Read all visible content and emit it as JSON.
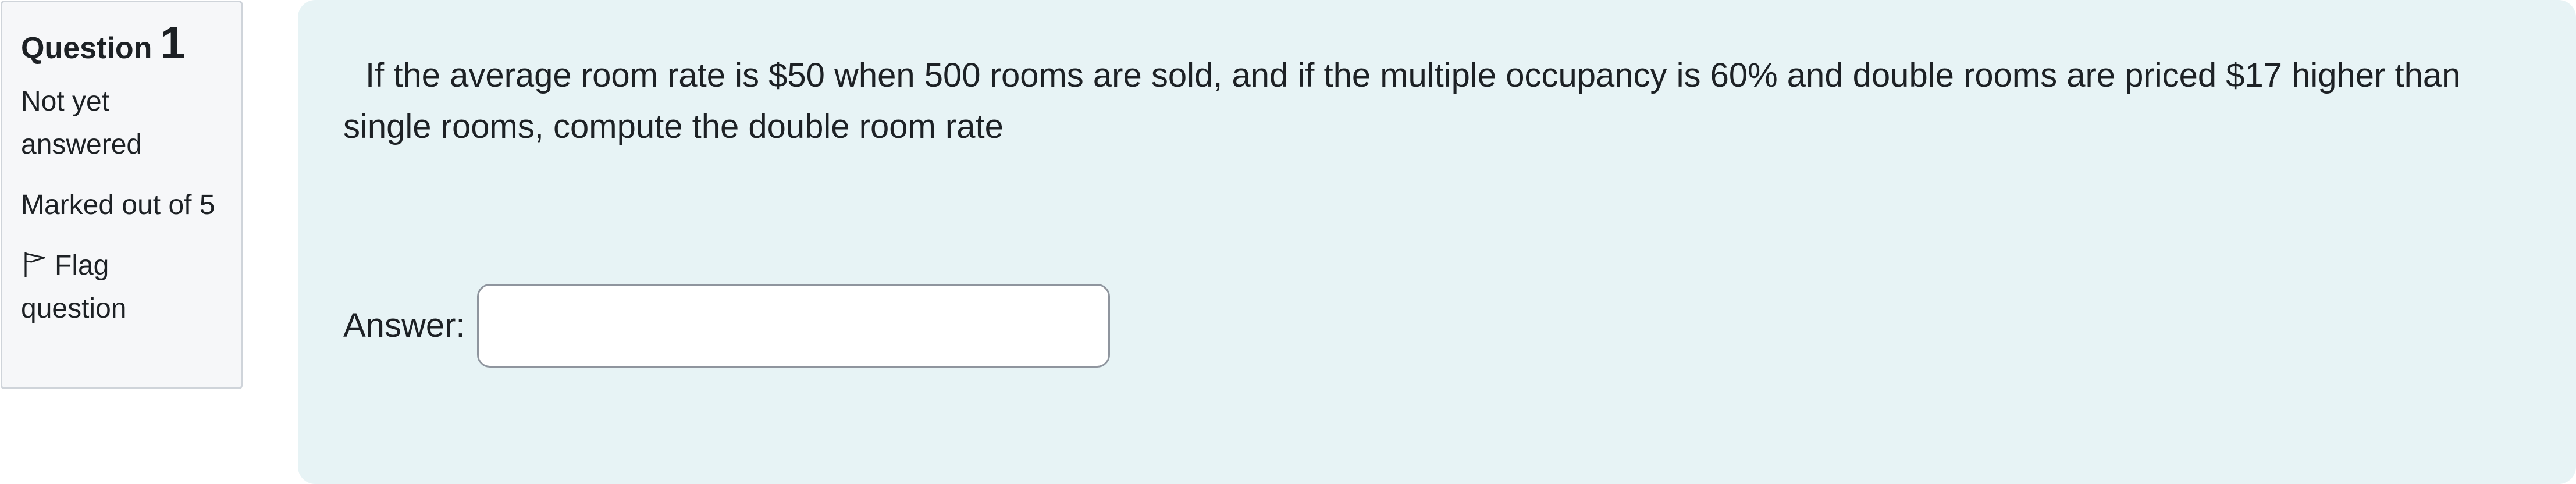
{
  "question_info": {
    "label": "Question",
    "number": "1",
    "state": "Not yet answered",
    "marks": "Marked out of 5",
    "flag_label": "Flag question"
  },
  "question": {
    "text": "If the average room rate is $50 when 500 rooms are sold, and if the multiple occupancy is 60% and double rooms are priced $17 higher than single rooms, compute the double room rate",
    "answer_label": "Answer:",
    "answer_value": ""
  },
  "colors": {
    "content_bg": "#e7f3f5",
    "info_bg": "#f6f7f9",
    "info_border": "#cfd4da"
  }
}
